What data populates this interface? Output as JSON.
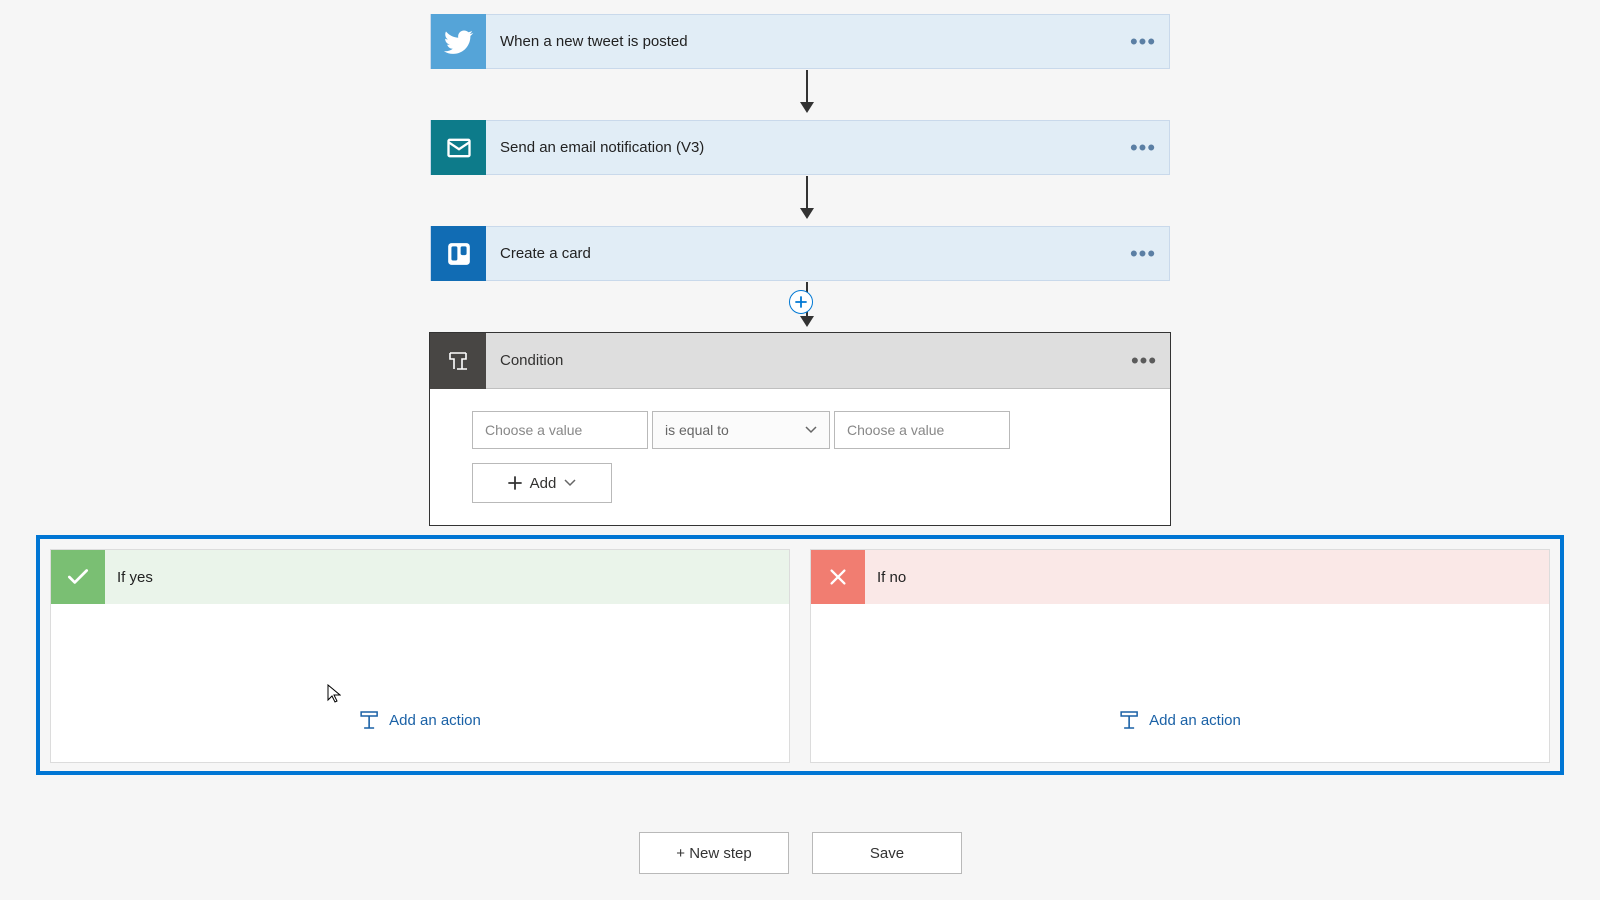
{
  "steps": {
    "twitter": {
      "label": "When a new tweet is posted"
    },
    "email": {
      "label": "Send an email notification (V3)"
    },
    "trello": {
      "label": "Create a card"
    }
  },
  "condition": {
    "title": "Condition",
    "value_left_placeholder": "Choose a value",
    "operator_label": "is equal to",
    "value_right_placeholder": "Choose a value",
    "add_label": "Add"
  },
  "branches": {
    "yes": {
      "title": "If yes",
      "add_action_label": "Add an action"
    },
    "no": {
      "title": "If no",
      "add_action_label": "Add an action"
    }
  },
  "footer": {
    "new_step_label": "+ New step",
    "save_label": "Save"
  },
  "colors": {
    "twitter": "#55a4d8",
    "email": "#0d7b8a",
    "trello": "#116cb4",
    "accent": "#0076d4"
  }
}
